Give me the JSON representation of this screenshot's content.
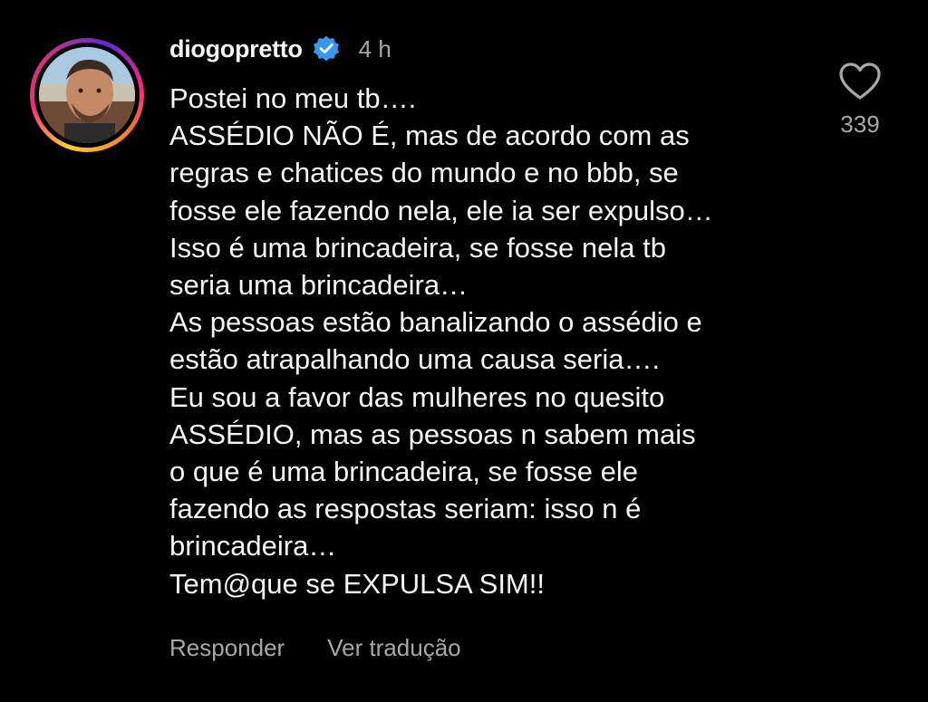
{
  "comment": {
    "username": "diogopretto",
    "verified_icon": "verified-badge-icon",
    "timestamp": "4 h",
    "lines": [
      "Postei no meu tb….",
      "ASSÉDIO NÃO É, mas de acordo com as",
      "regras e chatices do mundo e no bbb, se",
      "fosse ele fazendo nela, ele ia ser expulso…",
      "Isso é uma brincadeira, se fosse nela tb",
      "seria uma brincadeira…",
      "As pessoas estão banalizando o assédio e",
      "estão atrapalhando uma causa seria….",
      "Eu sou a favor das mulheres no quesito",
      "ASSÉDIO, mas as pessoas n sabem mais",
      "o que é uma brincadeira, se fosse ele",
      "fazendo as respostas seriam: isso n é",
      "brincadeira…",
      "Tem@que se EXPULSA SIM!!"
    ],
    "reply_label": "Responder",
    "translate_label": "Ver tradução",
    "like_icon": "heart-outline-icon",
    "like_count": "339"
  },
  "colors": {
    "background": "#000000",
    "text_primary": "#f5f5f5",
    "text_secondary": "#a8a8a8",
    "verified_blue": "#3897f0"
  }
}
